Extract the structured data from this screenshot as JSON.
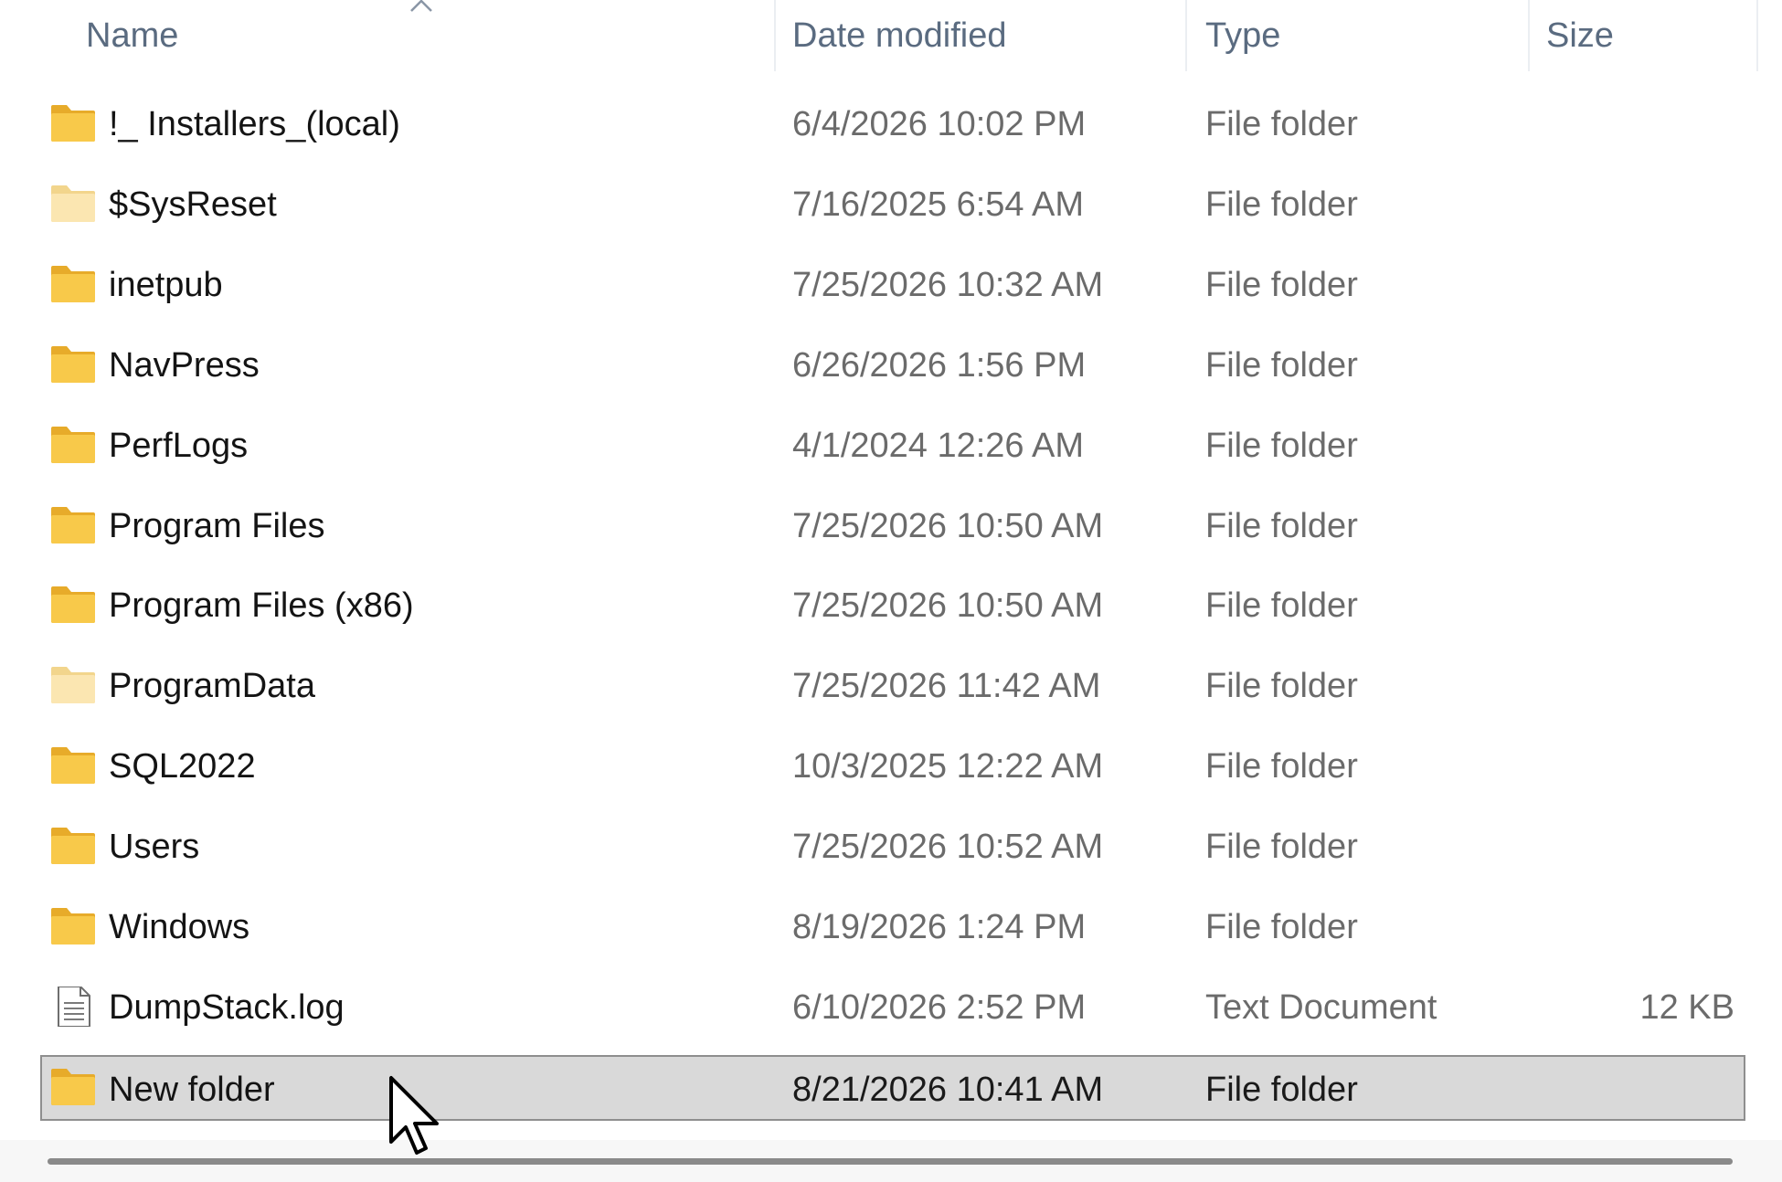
{
  "columns": {
    "name": "Name",
    "date": "Date modified",
    "type": "Type",
    "size": "Size"
  },
  "sort": {
    "column": "Name",
    "direction": "ascending",
    "icon": "chevron-up-icon"
  },
  "rows": [
    {
      "name": "!_ Installers_(local)",
      "date": "6/4/2026 10:02 PM",
      "type": "File folder",
      "size": "",
      "icon": "folder-icon"
    },
    {
      "name": "$SysReset",
      "date": "7/16/2025 6:54 AM",
      "type": "File folder",
      "size": "",
      "icon": "hidden-folder-icon"
    },
    {
      "name": "inetpub",
      "date": "7/25/2026 10:32 AM",
      "type": "File folder",
      "size": "",
      "icon": "folder-icon"
    },
    {
      "name": "NavPress",
      "date": "6/26/2026 1:56 PM",
      "type": "File folder",
      "size": "",
      "icon": "folder-icon"
    },
    {
      "name": "PerfLogs",
      "date": "4/1/2024 12:26 AM",
      "type": "File folder",
      "size": "",
      "icon": "folder-icon"
    },
    {
      "name": "Program Files",
      "date": "7/25/2026 10:50 AM",
      "type": "File folder",
      "size": "",
      "icon": "folder-icon"
    },
    {
      "name": "Program Files (x86)",
      "date": "7/25/2026 10:50 AM",
      "type": "File folder",
      "size": "",
      "icon": "folder-icon"
    },
    {
      "name": "ProgramData",
      "date": "7/25/2026 11:42 AM",
      "type": "File folder",
      "size": "",
      "icon": "hidden-folder-icon"
    },
    {
      "name": "SQL2022",
      "date": "10/3/2025 12:22 AM",
      "type": "File folder",
      "size": "",
      "icon": "folder-icon"
    },
    {
      "name": "Users",
      "date": "7/25/2026 10:52 AM",
      "type": "File folder",
      "size": "",
      "icon": "folder-icon"
    },
    {
      "name": "Windows",
      "date": "8/19/2026 1:24 PM",
      "type": "File folder",
      "size": "",
      "icon": "folder-icon"
    },
    {
      "name": "DumpStack.log",
      "date": "6/10/2026 2:52 PM",
      "type": "Text Document",
      "size": "12 KB",
      "icon": "text-document-icon"
    },
    {
      "name": "New folder",
      "date": "8/21/2026 10:41 AM",
      "type": "File folder",
      "size": "",
      "icon": "folder-icon",
      "selected": true
    }
  ],
  "colors": {
    "folder": "#f8c94a",
    "folder_dark": "#e7ab2a",
    "hidden_folder": "#fbe6b1",
    "selection_bg": "#d9d9d9",
    "selection_border": "#8e8e8e",
    "header_text": "#5a6b80",
    "secondary_text": "#6b6b6b"
  },
  "cursor": "mouse-pointer-icon"
}
